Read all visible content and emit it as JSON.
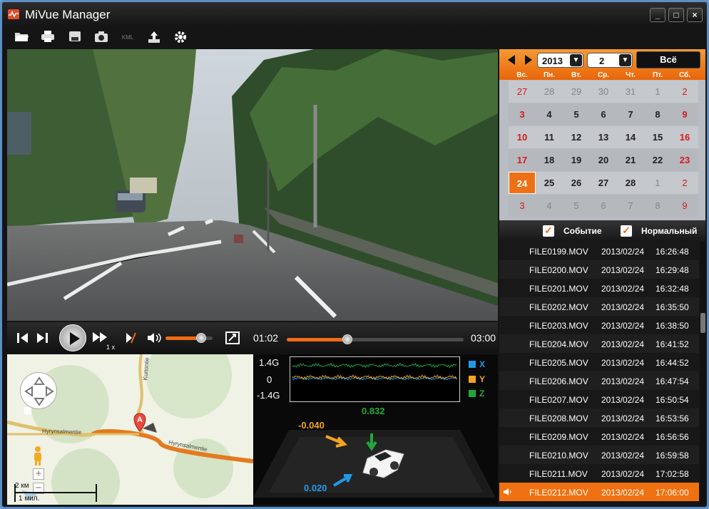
{
  "app": {
    "title": "MiVue Manager",
    "window_buttons": {
      "minimize": "_",
      "maximize": "□",
      "close": "×"
    }
  },
  "toolbar": {
    "items": [
      "open-folder",
      "print",
      "save",
      "snapshot",
      "kml",
      "export",
      "settings"
    ],
    "kml_label": "KML"
  },
  "playback": {
    "speed_label": "1 x",
    "current_time": "01:02",
    "total_time": "03:00",
    "progress_fraction": 0.344,
    "volume_fraction": 0.75
  },
  "map": {
    "road_label_vertical": "Kurtontie",
    "road_label_top": "Hyrynsalmentie",
    "road_label_bottom": "Hyrynsalmentie",
    "marker_label": "A",
    "scale_km": "2 км",
    "scale_miles": "1 мил."
  },
  "gsensor": {
    "axis_top": "1.4G",
    "axis_mid": "0",
    "axis_bottom": "-1.4G",
    "legend": [
      {
        "label": "X",
        "color": "#1e9be8"
      },
      {
        "label": "Y",
        "color": "#f5a51b"
      },
      {
        "label": "Z",
        "color": "#22a83a"
      }
    ],
    "readout_x": "-0.040",
    "readout_z": "0.832",
    "readout_y": "0.020"
  },
  "calendar": {
    "year": "2013",
    "month": "2",
    "all_button": "Всё",
    "weekdays": [
      "Вс.",
      "Пн.",
      "Вт.",
      "Ср.",
      "Чт.",
      "Пт.",
      "Сб."
    ],
    "rows": [
      [
        "27",
        "28",
        "29",
        "30",
        "31",
        "1",
        "2"
      ],
      [
        "3",
        "4",
        "5",
        "6",
        "7",
        "8",
        "9"
      ],
      [
        "10",
        "11",
        "12",
        "13",
        "14",
        "15",
        "16"
      ],
      [
        "17",
        "18",
        "19",
        "20",
        "21",
        "22",
        "23"
      ],
      [
        "24",
        "25",
        "26",
        "27",
        "28",
        "1",
        "2"
      ],
      [
        "3",
        "4",
        "5",
        "6",
        "7",
        "8",
        "9"
      ]
    ],
    "selected_day": "24"
  },
  "filters": {
    "event_label": "Событие",
    "normal_label": "Нормальный",
    "check_mark": "✓"
  },
  "files": [
    {
      "name": "FILE0199.MOV",
      "date": "2013/02/24",
      "time": "16:26:48"
    },
    {
      "name": "FILE0200.MOV",
      "date": "2013/02/24",
      "time": "16:29:48"
    },
    {
      "name": "FILE0201.MOV",
      "date": "2013/02/24",
      "time": "16:32:48"
    },
    {
      "name": "FILE0202.MOV",
      "date": "2013/02/24",
      "time": "16:35:50"
    },
    {
      "name": "FILE0203.MOV",
      "date": "2013/02/24",
      "time": "16:38:50"
    },
    {
      "name": "FILE0204.MOV",
      "date": "2013/02/24",
      "time": "16:41:52"
    },
    {
      "name": "FILE0205.MOV",
      "date": "2013/02/24",
      "time": "16:44:52"
    },
    {
      "name": "FILE0206.MOV",
      "date": "2013/02/24",
      "time": "16:47:54"
    },
    {
      "name": "FILE0207.MOV",
      "date": "2013/02/24",
      "time": "16:50:54"
    },
    {
      "name": "FILE0208.MOV",
      "date": "2013/02/24",
      "time": "16:53:56"
    },
    {
      "name": "FILE0209.MOV",
      "date": "2013/02/24",
      "time": "16:56:56"
    },
    {
      "name": "FILE0210.MOV",
      "date": "2013/02/24",
      "time": "16:59:58"
    },
    {
      "name": "FILE0211.MOV",
      "date": "2013/02/24",
      "time": "17:02:58"
    },
    {
      "name": "FILE0212.MOV",
      "date": "2013/02/24",
      "time": "17:06:00"
    }
  ],
  "selected_file": "FILE0212.MOV",
  "colors": {
    "accent": "#f06b16",
    "window_border": "#5b8fc6",
    "background": "#151515"
  }
}
